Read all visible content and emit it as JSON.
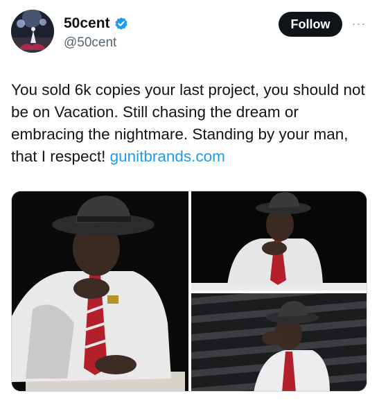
{
  "author": {
    "display_name": "50cent",
    "handle": "@50cent",
    "verified": true,
    "avatar_icon": "concert-avatar-photo"
  },
  "actions": {
    "follow_label": "Follow",
    "more_label": "···"
  },
  "tweet": {
    "text": "You sold 6k copies your last project, you should not be on Vacation. Still chasing the dream or embracing the nightmare. Standing by your man, that I respect! ",
    "link_text": "gunitbrands.com"
  },
  "colors": {
    "link": "#1d9bf0",
    "verified_badge": "#1d9bf0",
    "follow_button_bg": "#0f1419",
    "handle_text": "#536471"
  },
  "media": {
    "photos": [
      {
        "name": "photo-man-in-fedora-seated"
      },
      {
        "name": "photo-man-in-fedora-at-table"
      },
      {
        "name": "photo-man-in-fedora-striped-shadow"
      }
    ]
  }
}
